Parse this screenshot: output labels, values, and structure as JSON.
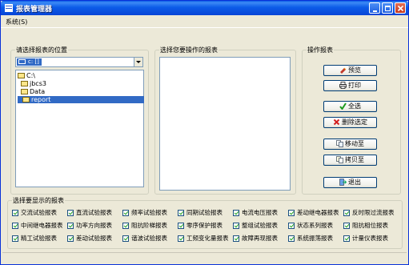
{
  "window": {
    "title": "报表管理器"
  },
  "menu": {
    "system": "系统(S)"
  },
  "groups": {
    "location": "请选择报表的位置",
    "reports": "选择您要操作的报表",
    "actions": "操作报表",
    "display": "选择要显示的报表"
  },
  "location": {
    "drive_selected": "c: []",
    "tree": [
      "C:\\",
      "jbcs3",
      "Data",
      "report"
    ]
  },
  "buttons": {
    "preview": "预览",
    "print": "打印",
    "select_all": "全选",
    "deselect": "删除选定",
    "move": "移动至",
    "copy": "拷贝至",
    "exit": "退出"
  },
  "report_types": {
    "row1": [
      "交流试验报表",
      "直流试验报表",
      "频率试验报表",
      "同期试验报表",
      "电流电压报表",
      "差动继电器报表",
      "反时限过流报表"
    ],
    "row2": [
      "中间继电器报表",
      "功率方向报表",
      "阻抗阶梯报表",
      "零序保护报表",
      "整组试验报表",
      "状态系列报表",
      "阻抗相位报表"
    ],
    "row3": [
      "精工试验报表",
      "差动试验报表",
      "谐波试验报表",
      "工频变化量报表",
      "故障再现报表",
      "系统振荡报表",
      "计量仪表报表"
    ]
  },
  "colors": {
    "titlebar": "#0a5ae6",
    "selection": "#316ac5",
    "window_bg": "#ece9d8"
  }
}
